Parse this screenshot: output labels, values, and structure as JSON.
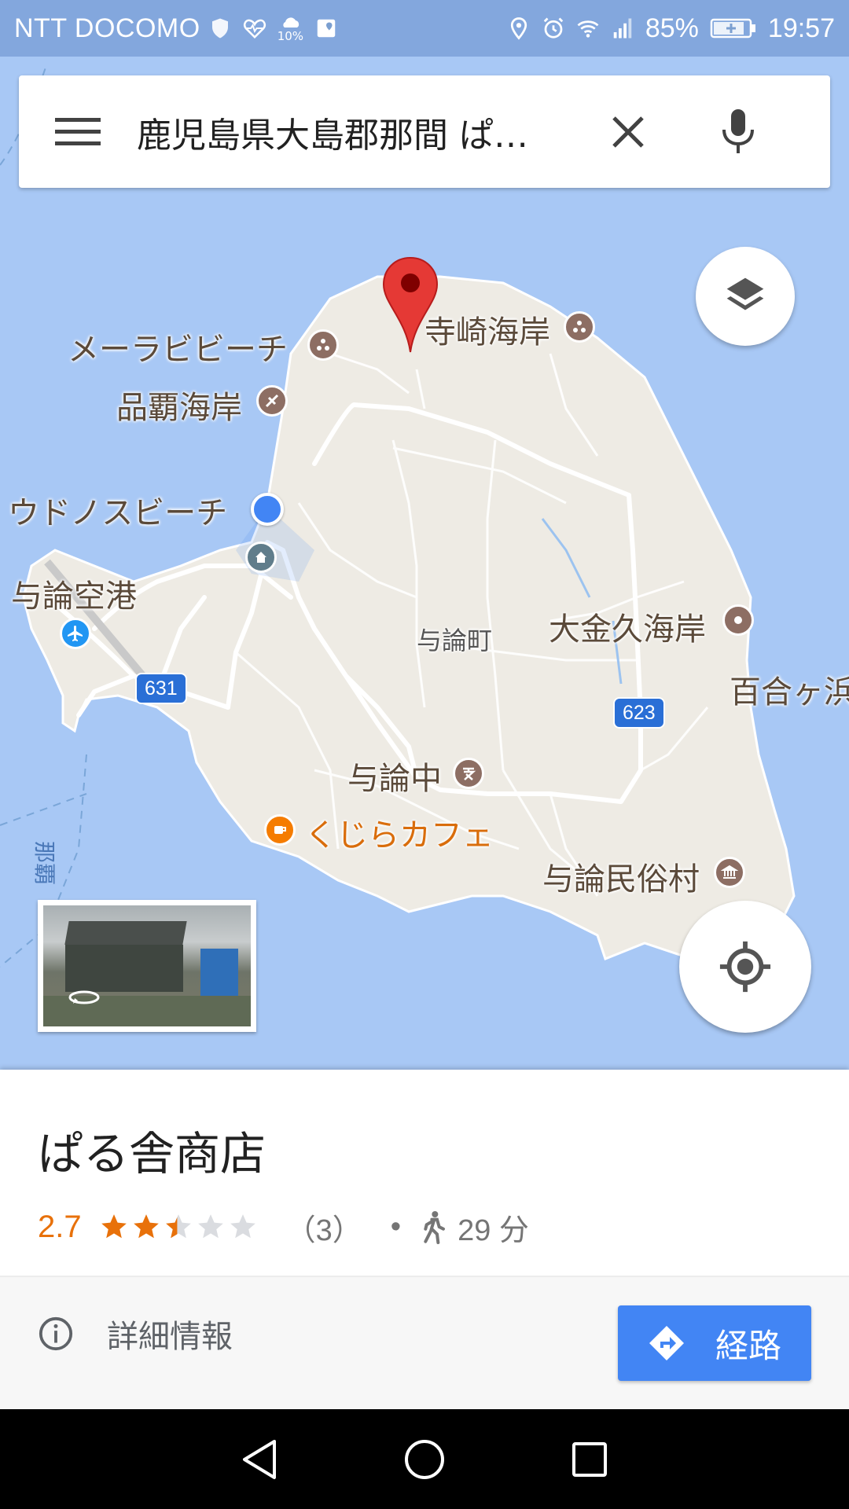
{
  "status_bar": {
    "carrier": "NTT DOCOMO",
    "weather_percent": "10%",
    "battery": "85%",
    "time": "19:57"
  },
  "search": {
    "query": "鹿児島県大島郡那間 ぱ…"
  },
  "map": {
    "labels": {
      "mera_beach": "メーラビビーチ",
      "terazaki": "寺崎海岸",
      "shinpa": "品覇海岸",
      "udonosu": "ウドノスビーチ",
      "airport": "与論空港",
      "yoron_town": "与論町",
      "okinku": "大金久海岸",
      "yurigahama": "百合ヶ浜",
      "yoron_junior": "与論中",
      "kujira_cafe": "くじらカフェ",
      "folk_village": "与論民俗村",
      "route_631": "631",
      "route_623": "623",
      "nama_vertical": "那覇"
    },
    "colors": {
      "sea": "#a8c8f5",
      "land": "#eeebe4",
      "road": "#ffffff",
      "marker": "#e53935",
      "my_location": "#4285f4"
    }
  },
  "place_card": {
    "title": "ぱる舎商店",
    "rating": "2.7",
    "stars_value": 2.7,
    "review_count": "（3）",
    "separator": "•",
    "walk_time": "29 分",
    "details_label": "詳細情報",
    "directions_label": "経路"
  },
  "icons": [
    "menu-icon",
    "close-icon",
    "mic-icon",
    "layers-icon",
    "my-location-icon",
    "info-icon",
    "directions-icon",
    "walk-icon",
    "star-icon",
    "back-icon",
    "home-icon",
    "recents-icon"
  ]
}
